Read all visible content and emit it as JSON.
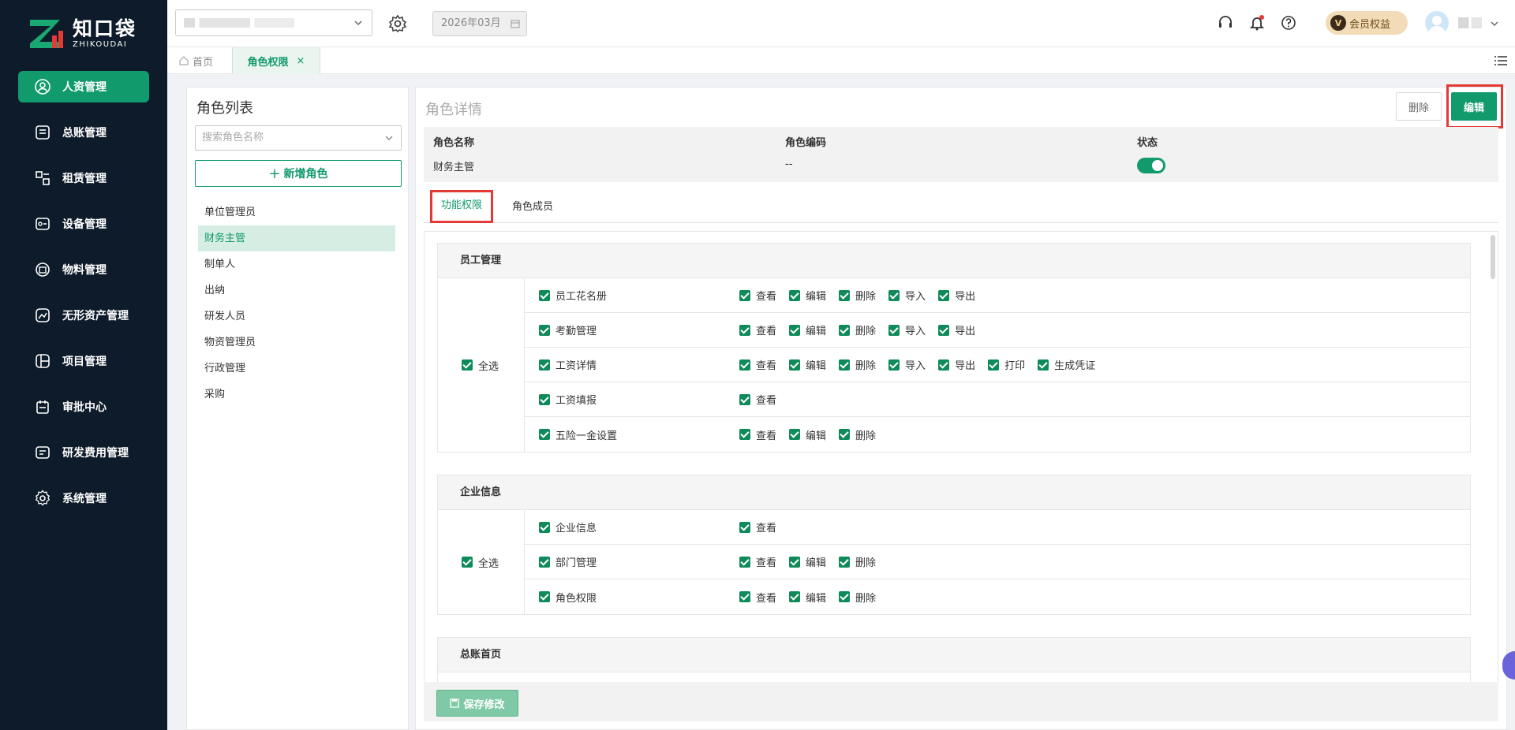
{
  "brand": {
    "name_cn": "知口袋",
    "name_en": "ZHIKOUDAI",
    "color": "#119a6b"
  },
  "sidebar": {
    "items": [
      {
        "label": "人资管理",
        "icon": "user-circle-icon",
        "active": true
      },
      {
        "label": "总账管理",
        "icon": "ledger-icon"
      },
      {
        "label": "租赁管理",
        "icon": "lease-icon"
      },
      {
        "label": "设备管理",
        "icon": "device-icon"
      },
      {
        "label": "物料管理",
        "icon": "materials-icon"
      },
      {
        "label": "无形资产管理",
        "icon": "intangible-asset-icon"
      },
      {
        "label": "项目管理",
        "icon": "project-icon"
      },
      {
        "label": "审批中心",
        "icon": "approval-icon"
      },
      {
        "label": "研发费用管理",
        "icon": "rd-expense-icon"
      },
      {
        "label": "系统管理",
        "icon": "gear-icon"
      }
    ]
  },
  "topbar": {
    "month": "2026年03月",
    "vip_label": "会员权益",
    "vip_badge": "V"
  },
  "tabs": {
    "home": "首页",
    "current": "角色权限"
  },
  "role_list": {
    "title": "角色列表",
    "search_placeholder": "搜索角色名称",
    "add_button": "新增角色",
    "roles": [
      "单位管理员",
      "财务主管",
      "制单人",
      "出纳",
      "研发人员",
      "物资管理员",
      "行政管理",
      "采购"
    ],
    "selected": "财务主管"
  },
  "role_detail": {
    "title": "角色详情",
    "delete_label": "删除",
    "edit_label": "编辑",
    "columns": {
      "name_label": "角色名称",
      "name_value": "财务主管",
      "code_label": "角色编码",
      "code_value": "--",
      "status_label": "状态",
      "status_on": true
    },
    "subtabs": {
      "functions": "功能权限",
      "members": "角色成员"
    }
  },
  "permissions": {
    "select_all_label": "全选",
    "groups": [
      {
        "title": "员工管理",
        "rows": [
          {
            "name": "员工花名册",
            "actions": [
              "查看",
              "编辑",
              "删除",
              "导入",
              "导出"
            ]
          },
          {
            "name": "考勤管理",
            "actions": [
              "查看",
              "编辑",
              "删除",
              "导入",
              "导出"
            ]
          },
          {
            "name": "工资详情",
            "actions": [
              "查看",
              "编辑",
              "删除",
              "导入",
              "导出",
              "打印",
              "生成凭证"
            ]
          },
          {
            "name": "工资填报",
            "actions": [
              "查看"
            ]
          },
          {
            "name": "五险一金设置",
            "actions": [
              "查看",
              "编辑",
              "删除"
            ]
          }
        ]
      },
      {
        "title": "企业信息",
        "rows": [
          {
            "name": "企业信息",
            "actions": [
              "查看"
            ]
          },
          {
            "name": "部门管理",
            "actions": [
              "查看",
              "编辑",
              "删除"
            ]
          },
          {
            "name": "角色权限",
            "actions": [
              "查看",
              "编辑",
              "删除"
            ]
          }
        ]
      },
      {
        "title": "总账首页",
        "rows": []
      }
    ]
  },
  "footer": {
    "save_label": "保存修改"
  }
}
